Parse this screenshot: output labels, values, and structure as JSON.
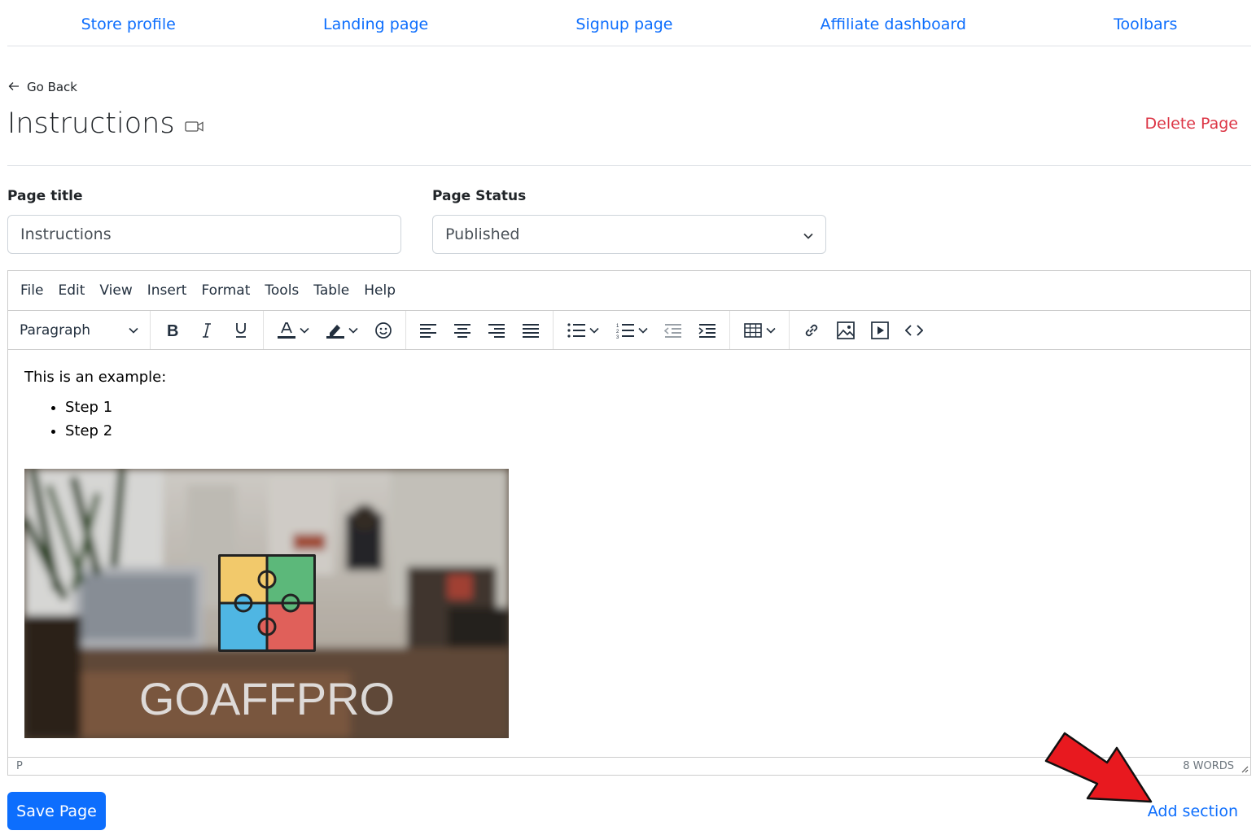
{
  "nav": {
    "items": [
      {
        "label": "Store profile"
      },
      {
        "label": "Landing page"
      },
      {
        "label": "Signup page"
      },
      {
        "label": "Affiliate dashboard"
      },
      {
        "label": "Toolbars"
      }
    ]
  },
  "header": {
    "back_label": "Go Back",
    "title": "Instructions",
    "delete_label": "Delete Page"
  },
  "form": {
    "page_title_label": "Page title",
    "page_title_value": "Instructions",
    "status_label": "Page Status",
    "status_value": "Published"
  },
  "editor": {
    "menu": [
      "File",
      "Edit",
      "View",
      "Insert",
      "Format",
      "Tools",
      "Table",
      "Help"
    ],
    "block_format": "Paragraph",
    "content": {
      "paragraph": "This is an example:",
      "list": [
        "Step 1",
        "Step 2"
      ],
      "image_logo_text": "GOAFFPRO"
    },
    "status_path": "P",
    "word_count": "8 WORDS"
  },
  "actions": {
    "save_label": "Save Page",
    "add_section_label": "Add section"
  },
  "colors": {
    "link": "#0d6efd",
    "danger": "#dc3545",
    "primary_button": "#0d6efd",
    "annotation_arrow": "#e8191f"
  }
}
